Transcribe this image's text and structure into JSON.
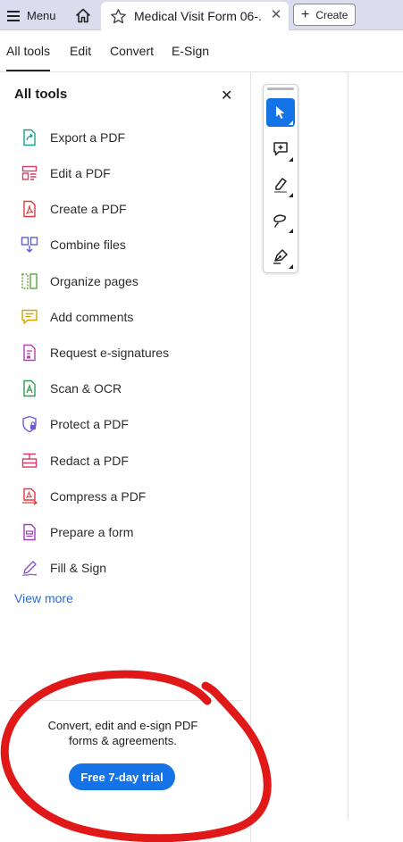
{
  "topbar": {
    "menu_label": "Menu",
    "doc_title": "Medical Visit Form 06-...",
    "close_symbol": "✕",
    "create_label": "Create",
    "bg_color": "#dcdcef"
  },
  "nav": {
    "tabs": [
      {
        "label": "All tools",
        "active": true
      },
      {
        "label": "Edit",
        "active": false
      },
      {
        "label": "Convert",
        "active": false
      },
      {
        "label": "E-Sign",
        "active": false
      }
    ]
  },
  "panel": {
    "title": "All tools",
    "close_symbol": "✕",
    "tools": [
      {
        "label": "Export a PDF",
        "icon": "export-pdf-icon",
        "color": "#1f9e8d"
      },
      {
        "label": "Edit a PDF",
        "icon": "edit-pdf-icon",
        "color": "#d83b63"
      },
      {
        "label": "Create a PDF",
        "icon": "create-pdf-icon",
        "color": "#e0393e"
      },
      {
        "label": "Combine files",
        "icon": "combine-files-icon",
        "color": "#5b5fd6"
      },
      {
        "label": "Organize pages",
        "icon": "organize-pages-icon",
        "color": "#5aa73b"
      },
      {
        "label": "Add comments",
        "icon": "add-comments-icon",
        "color": "#d4a400"
      },
      {
        "label": "Request e-signatures",
        "icon": "request-esignatures-icon",
        "color": "#b040b8"
      },
      {
        "label": "Scan & OCR",
        "icon": "scan-ocr-icon",
        "color": "#2e9e55"
      },
      {
        "label": "Protect a PDF",
        "icon": "protect-pdf-icon",
        "color": "#6b5bd6"
      },
      {
        "label": "Redact a PDF",
        "icon": "redact-pdf-icon",
        "color": "#d83b63"
      },
      {
        "label": "Compress a PDF",
        "icon": "compress-pdf-icon",
        "color": "#e0393e"
      },
      {
        "label": "Prepare a form",
        "icon": "prepare-form-icon",
        "color": "#9b3fb5"
      },
      {
        "label": "Fill & Sign",
        "icon": "fill-sign-icon",
        "color": "#8a4fd4"
      }
    ],
    "view_more": "View more",
    "promo_text": "Convert, edit and e-sign PDF forms & agreements.",
    "trial_button": "Free 7-day trial"
  },
  "toolbar": {
    "tools": [
      {
        "icon": "select-arrow-icon",
        "selected": true
      },
      {
        "icon": "add-comment-icon",
        "selected": false
      },
      {
        "icon": "highlight-icon",
        "selected": false
      },
      {
        "icon": "freehand-draw-icon",
        "selected": false
      },
      {
        "icon": "sign-pen-icon",
        "selected": false
      }
    ]
  },
  "colors": {
    "accent": "#1473e6",
    "link": "#2e6bd3",
    "annotation": "#e01818"
  }
}
